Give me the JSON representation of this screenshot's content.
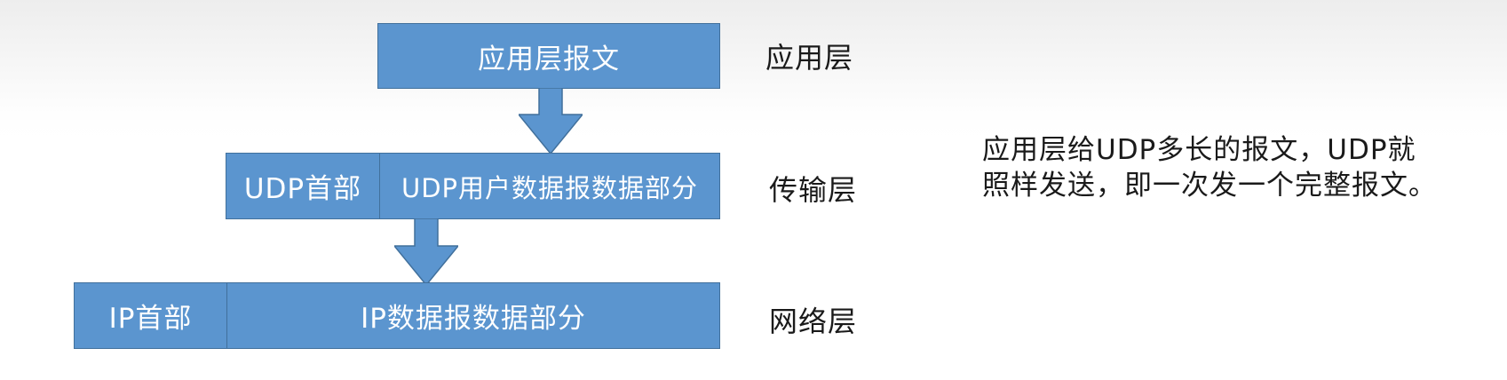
{
  "blocks": {
    "app_message": "应用层报文",
    "udp_header": "UDP首部",
    "udp_data": "UDP用户数据报数据部分",
    "ip_header": "IP首部",
    "ip_data": "IP数据报数据部分"
  },
  "layers": {
    "application": "应用层",
    "transport": "传输层",
    "network": "网络层"
  },
  "note": {
    "line1": "应用层给UDP多长的报文，UDP就",
    "line2": "照样发送，即一次发一个完整报文。"
  },
  "colors": {
    "box_fill": "#5b95cf",
    "box_border": "#41709c"
  }
}
